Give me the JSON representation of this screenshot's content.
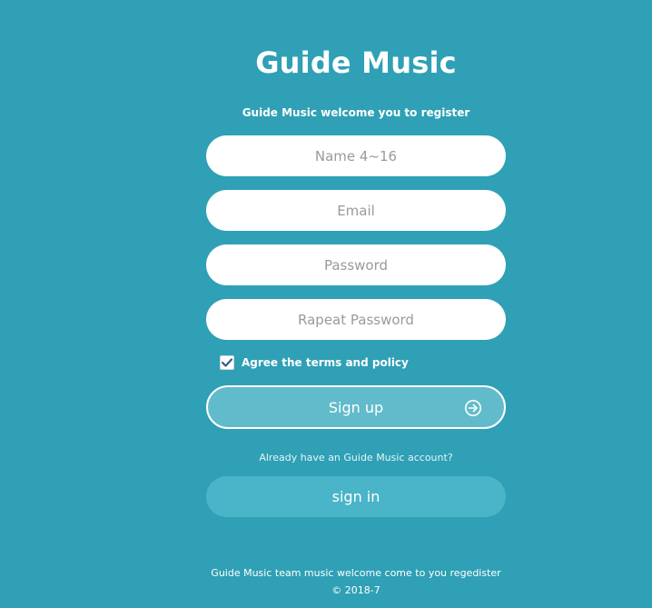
{
  "app": {
    "title": "Guide Music",
    "subtitle": "Guide Music welcome you to register"
  },
  "form": {
    "name_placeholder": "Name 4~16",
    "email_placeholder": "Email",
    "password_placeholder": "Password",
    "repeat_password_placeholder": "Rapeat Password",
    "agree_label": "Agree the terms and policy",
    "agree_checked": true,
    "signup_label": "Sign up",
    "signup_icon": "arrow-right-circle-icon"
  },
  "signin": {
    "prompt": "Already have an Guide Music account?",
    "button_label": "sign in"
  },
  "footer": {
    "line1": "Guide Music team music welcome come to you regedister",
    "line2": "© 2018-7"
  },
  "colors": {
    "background": "#2fa0b5",
    "signup_button": "#62bbcb",
    "signin_button": "#4ab4c8",
    "checkmark": "#3b5a8a"
  }
}
